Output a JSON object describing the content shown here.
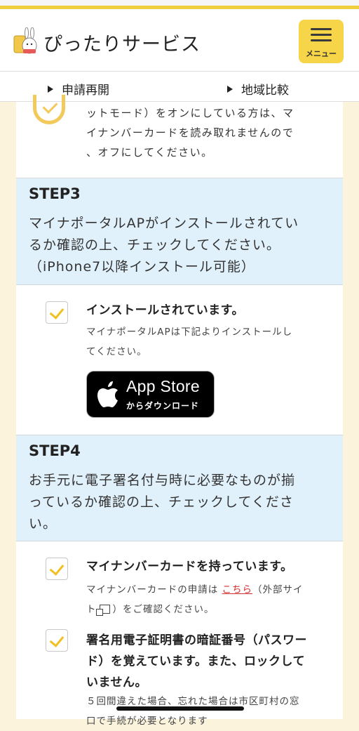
{
  "header": {
    "title": "ぴったりサービス",
    "menu_label": "メニュー"
  },
  "nav": {
    "items": [
      "申請再開",
      "地域比較"
    ]
  },
  "top_note": {
    "lines": [
      "ットモード）をオンにしている方は、マ",
      "イナンバーカードを読み取れませんので",
      "、オフにしてください。"
    ]
  },
  "step3": {
    "title": "STEP3",
    "lines": [
      "マイナポータルAPがインストールされてい",
      "るか確認の上、チェックしてください。",
      "（iPhone7以降インストール可能）"
    ],
    "check": {
      "label": "インストールされています。",
      "sub_lines": [
        "マイナポータルAPは下記よりインストールし",
        "てください。"
      ]
    },
    "appstore": {
      "main": "App Store",
      "sub": "からダウンロード"
    }
  },
  "step4": {
    "title": "STEP4",
    "lines": [
      "お手元に電子署名付与時に必要なものが揃",
      "っているか確認の上、チェックしてくださ",
      "い。"
    ],
    "check1": {
      "label": "マイナンバーカードを持っています。",
      "sub_prefix": "マイナンバーカードの申請は ",
      "link": "こちら",
      "sub_suffix": "（外部サイ",
      "sub_line2_prefix": "ト",
      "sub_line2_suffix": "）をご確認ください。"
    },
    "check2": {
      "label_lines": [
        "署名用電子証明書の暗証番号（パスワー",
        "ド）を覚えています。また、ロックして",
        "いません。"
      ],
      "sub_lines": [
        "５回間違えた場合、忘れた場合は市区町村の窓",
        "口で手続が必要となります"
      ]
    }
  },
  "colors": {
    "accent_yellow": "#f6d548",
    "step_bg": "#e1f1fb",
    "link_red": "#d23030",
    "page_bg": "#fbf3dc"
  }
}
